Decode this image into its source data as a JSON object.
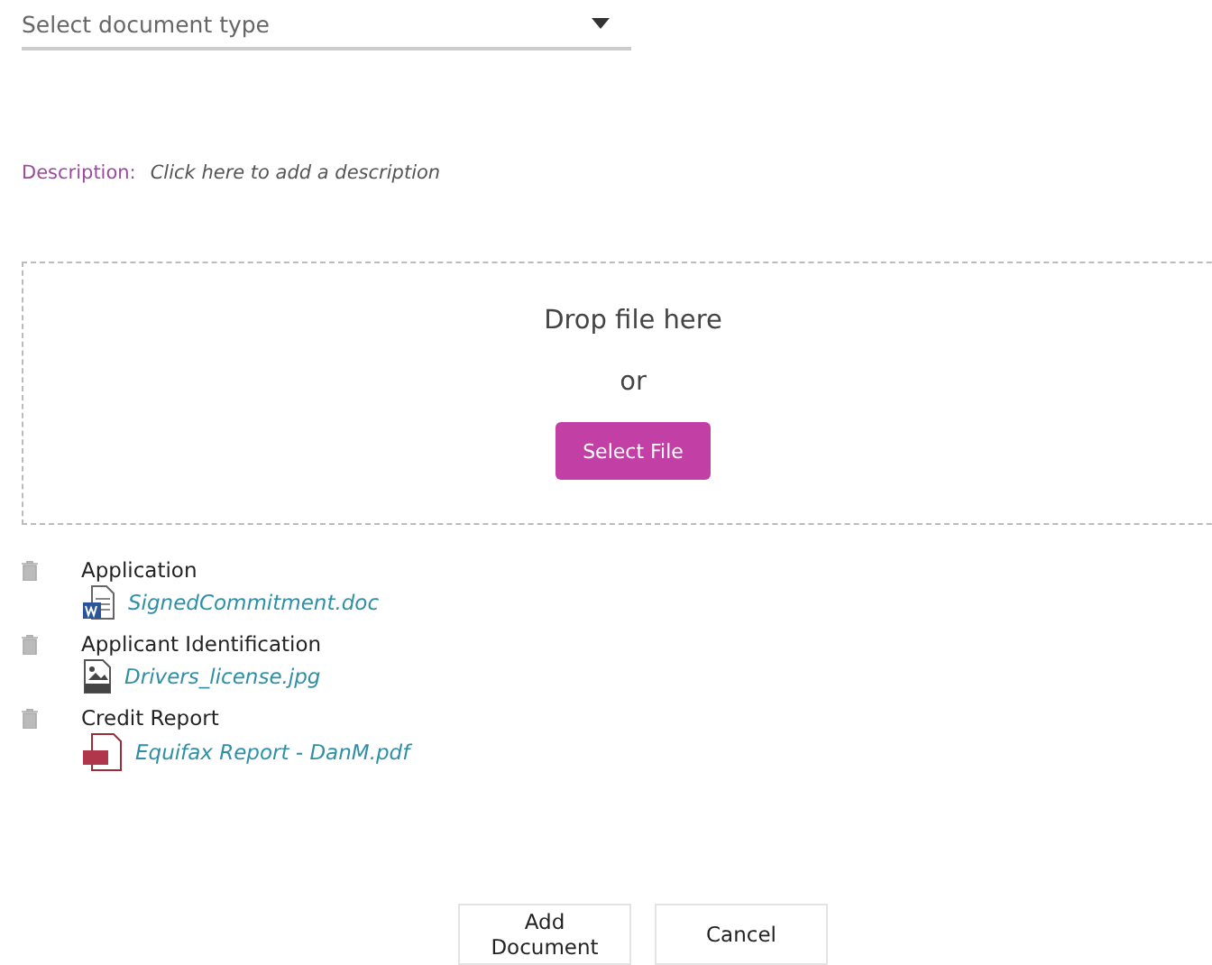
{
  "document_type": {
    "placeholder": "Select document type"
  },
  "description": {
    "label": "Description:",
    "placeholder": "Click here to add a description"
  },
  "drop_zone": {
    "prompt": "Drop file here",
    "or": "or",
    "button": "Select File"
  },
  "documents": [
    {
      "type": "Application",
      "file": "SignedCommitment.doc",
      "kind": "doc"
    },
    {
      "type": "Applicant Identification",
      "file": "Drivers_license.jpg",
      "kind": "image"
    },
    {
      "type": "Credit Report",
      "file": "Equifax Report - DanM.pdf",
      "kind": "pdf"
    }
  ],
  "buttons": [
    "Add Document",
    "Cancel"
  ]
}
